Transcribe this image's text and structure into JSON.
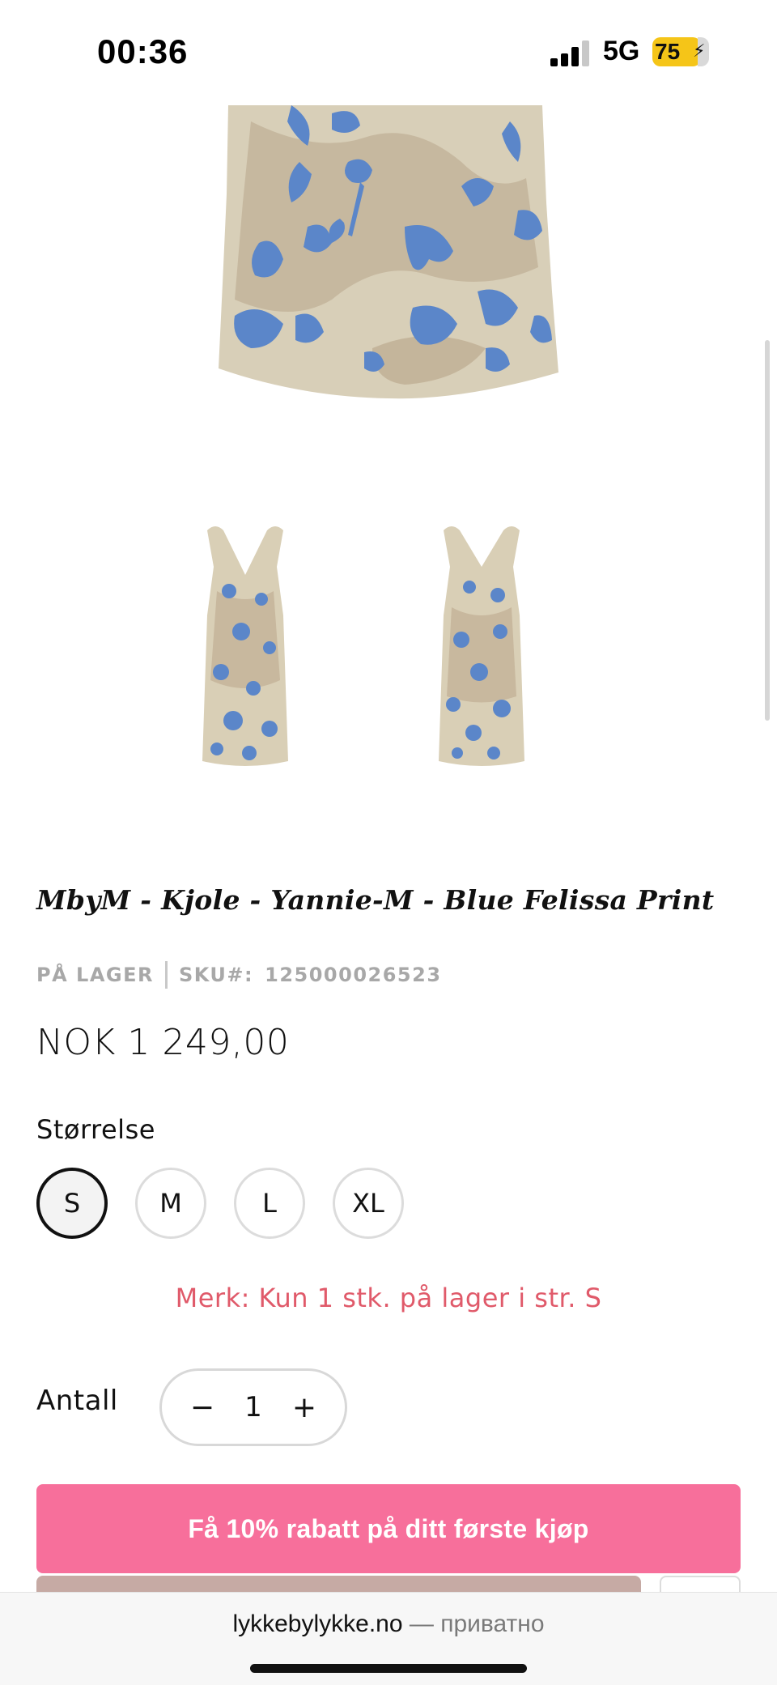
{
  "status_bar": {
    "time": "00:36",
    "network": "5G",
    "battery": "75",
    "battery_color": "#f5c518"
  },
  "product": {
    "title": "MbyM - Kjole - Yannie-M - Blue Felissa Print",
    "stock_status": "PÅ LAGER",
    "sku_label": "SKU#:",
    "sku": "125000026523",
    "price": "NOK 1 249,00",
    "print_colors": {
      "base": "#d9cfb6",
      "flowers": "#5b86c9",
      "shade": "#b9a88f"
    }
  },
  "size": {
    "label": "Størrelse",
    "options": [
      "S",
      "M",
      "L",
      "XL"
    ],
    "selected": "S"
  },
  "stock_note": "Merk: Kun 1 stk. på lager i str. S",
  "quantity": {
    "label": "Antall",
    "value": "1",
    "minus": "−",
    "plus": "+"
  },
  "promo_button": {
    "label": "Få 10% rabatt på ditt første kjøp",
    "color": "#f76f9b"
  },
  "browser": {
    "domain": "lykkebylykke.no",
    "suffix": " — приватно"
  }
}
